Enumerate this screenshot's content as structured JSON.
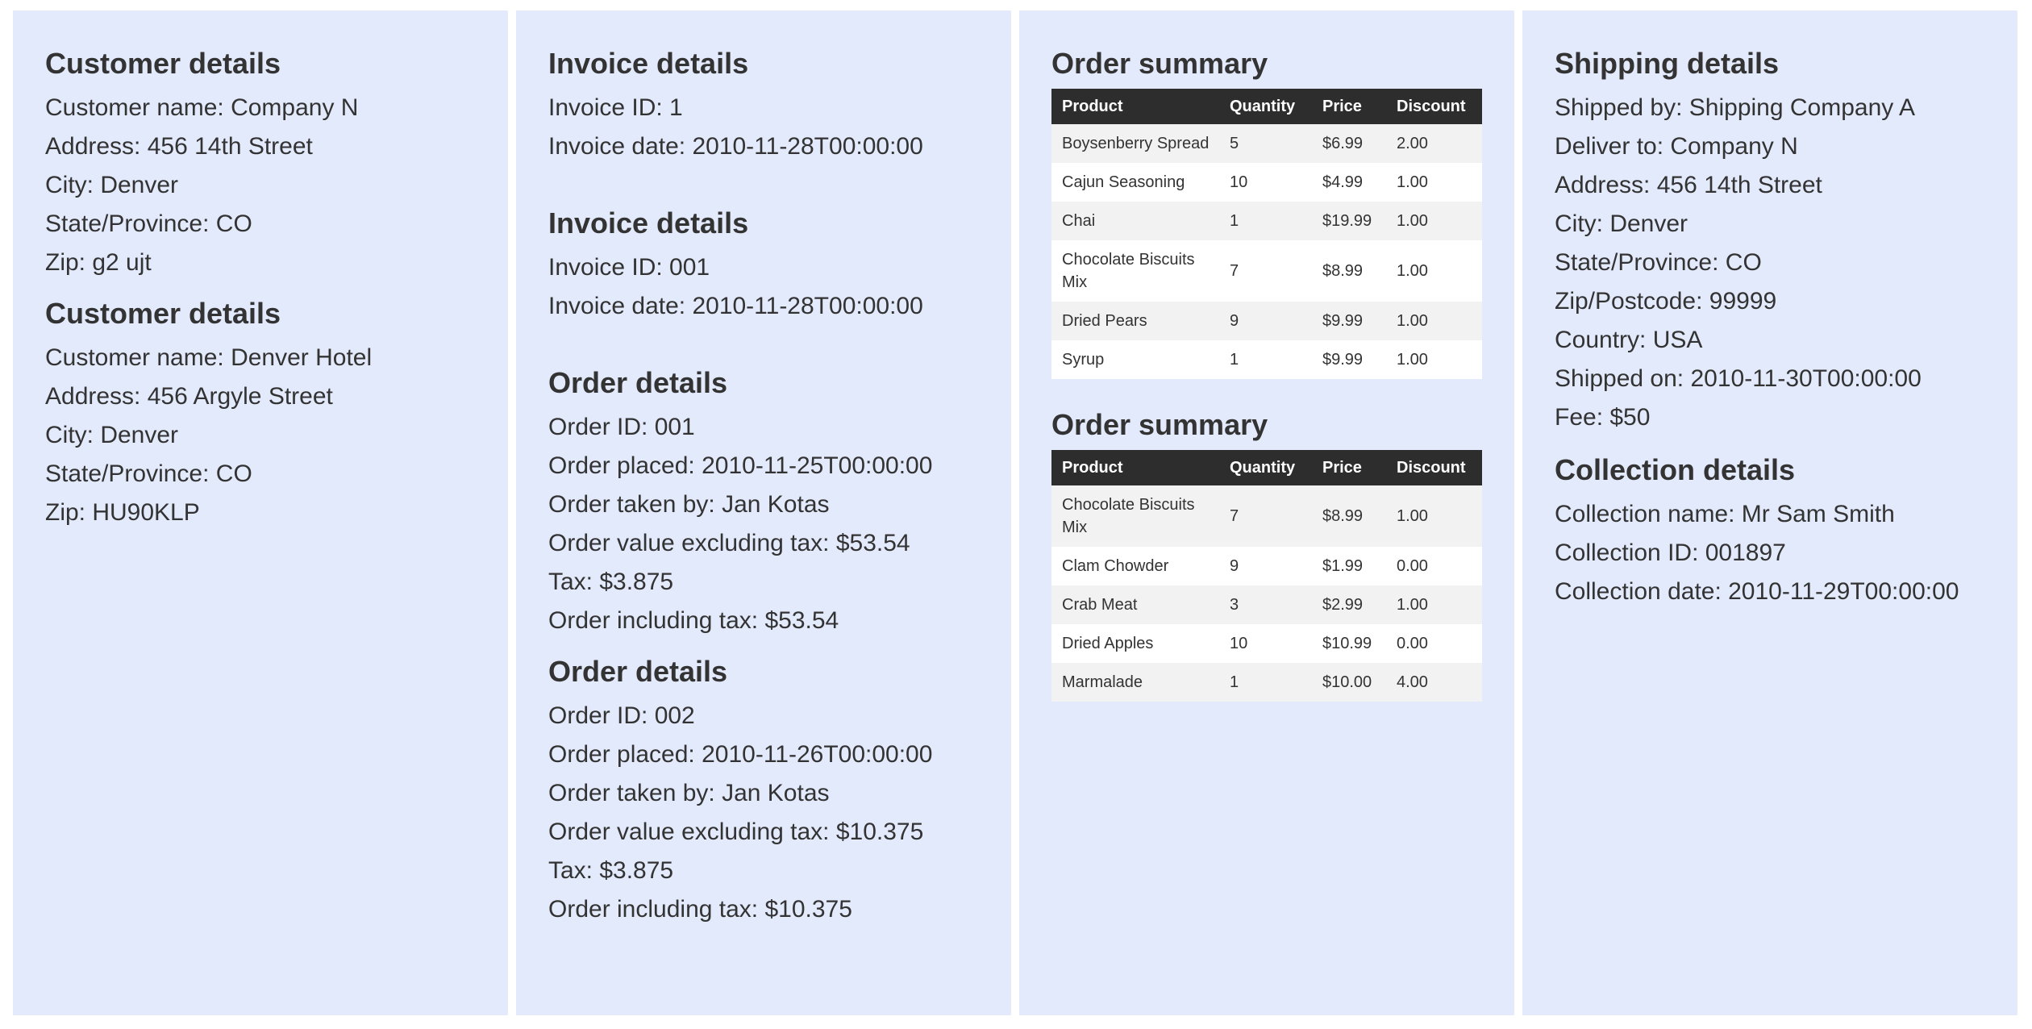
{
  "customers": [
    {
      "heading": "Customer details",
      "name": "Customer name: Company N",
      "address": "Address: 456 14th Street",
      "city": "City: Denver",
      "state": "State/Province: CO",
      "zip": "Zip: g2 ujt"
    },
    {
      "heading": "Customer details",
      "name": "Customer name: Denver Hotel",
      "address": "Address: 456 Argyle Street",
      "city": "City: Denver",
      "state": "State/Province: CO",
      "zip": "Zip: HU90KLP"
    }
  ],
  "invoices": [
    {
      "heading": "Invoice details",
      "id": "Invoice ID: 1",
      "date": "Invoice date: 2010-11-28T00:00:00"
    },
    {
      "heading": "Invoice details",
      "id": "Invoice ID: 001",
      "date": "Invoice date: 2010-11-28T00:00:00"
    }
  ],
  "orders": [
    {
      "heading": "Order details",
      "id": "Order ID: 001",
      "placed": "Order placed: 2010-11-25T00:00:00",
      "taken_by": "Order taken by: Jan Kotas",
      "value_ex_tax": "Order value excluding tax: $53.54",
      "tax": "Tax: $3.875",
      "incl_tax": "Order including tax: $53.54"
    },
    {
      "heading": "Order details",
      "id": "Order ID: 002",
      "placed": "Order placed: 2010-11-26T00:00:00",
      "taken_by": "Order taken by: Jan Kotas",
      "value_ex_tax": "Order value excluding tax: $10.375",
      "tax": "Tax: $3.875",
      "incl_tax": "Order including tax: $10.375"
    }
  ],
  "summaries": [
    {
      "heading": "Order summary",
      "columns": [
        "Product",
        "Quantity",
        "Price",
        "Discount"
      ],
      "rows": [
        [
          "Boysenberry Spread",
          "5",
          "$6.99",
          "2.00"
        ],
        [
          "Cajun Seasoning",
          "10",
          "$4.99",
          "1.00"
        ],
        [
          "Chai",
          "1",
          "$19.99",
          "1.00"
        ],
        [
          "Chocolate Biscuits Mix",
          "7",
          "$8.99",
          "1.00"
        ],
        [
          "Dried Pears",
          "9",
          "$9.99",
          "1.00"
        ],
        [
          "Syrup",
          "1",
          "$9.99",
          "1.00"
        ]
      ]
    },
    {
      "heading": "Order summary",
      "columns": [
        "Product",
        "Quantity",
        "Price",
        "Discount"
      ],
      "rows": [
        [
          "Chocolate Biscuits Mix",
          "7",
          "$8.99",
          "1.00"
        ],
        [
          "Clam Chowder",
          "9",
          "$1.99",
          "0.00"
        ],
        [
          "Crab Meat",
          "3",
          "$2.99",
          "1.00"
        ],
        [
          "Dried Apples",
          "10",
          "$10.99",
          "0.00"
        ],
        [
          "Marmalade",
          "1",
          "$10.00",
          "4.00"
        ]
      ]
    }
  ],
  "shipping": {
    "heading": "Shipping details",
    "shipped_by": "Shipped by: Shipping Company A",
    "deliver_to": "Deliver to: Company N",
    "address": "Address: 456 14th Street",
    "city": "City: Denver",
    "state": "State/Province: CO",
    "zip": "Zip/Postcode: 99999",
    "country": "Country: USA",
    "shipped_on": "Shipped on: 2010-11-30T00:00:00",
    "fee": "Fee: $50"
  },
  "collection": {
    "heading": "Collection details",
    "name": "Collection name: Mr Sam Smith",
    "id": "Collection ID: 001897",
    "date": "Collection date: 2010-11-29T00:00:00"
  },
  "colors": {
    "panel_bg": "#e3eafc",
    "table_header_bg": "#2d2d2d",
    "table_row_alt": "#f2f2f2",
    "text": "#333333"
  }
}
